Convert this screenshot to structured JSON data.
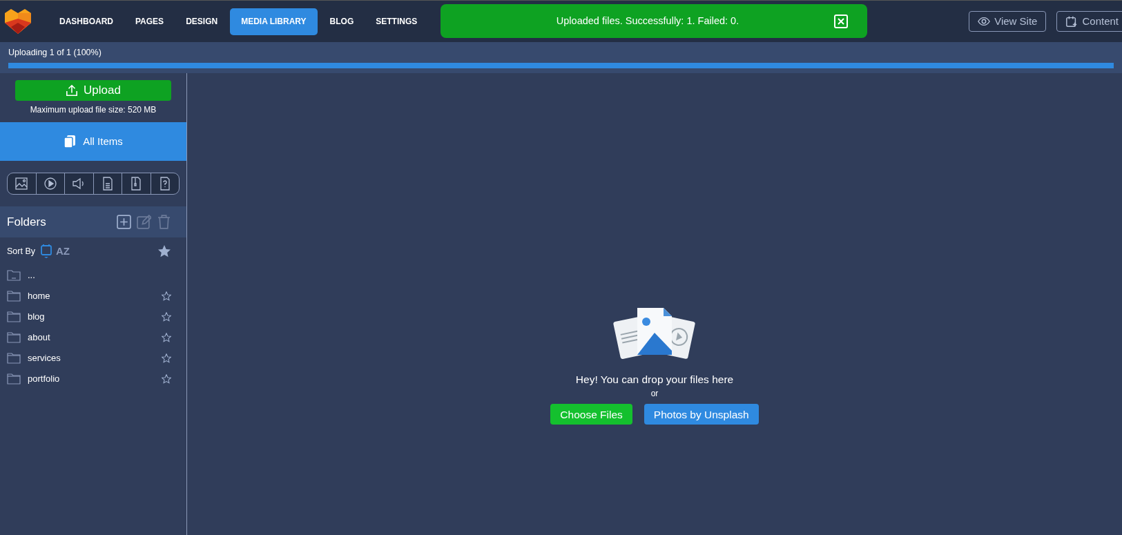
{
  "nav": {
    "tabs": [
      {
        "label": "DASHBOARD",
        "selected": false
      },
      {
        "label": "PAGES",
        "selected": false
      },
      {
        "label": "DESIGN",
        "selected": false
      },
      {
        "label": "MEDIA LIBRARY",
        "selected": true
      },
      {
        "label": "BLOG",
        "selected": false
      },
      {
        "label": "SETTINGS",
        "selected": false
      }
    ],
    "buttons": [
      {
        "kind": "view",
        "label": "View Site"
      },
      {
        "kind": "content",
        "label": "Content"
      }
    ]
  },
  "toast": {
    "message": "Uploaded files. Successfully: 1. Failed: 0."
  },
  "upload_progress": {
    "label": "Uploading 1 of 1 (100%)",
    "level": 1
  },
  "sidebar": {
    "upload_button": "Upload",
    "max_size": "Maximum upload file size: 520 MB",
    "all_items": {
      "label": "All Items",
      "selected": true
    },
    "folders_title": "Folders",
    "sort_label": "Sort By",
    "sort_options": [
      {
        "kind": "date",
        "selected": true
      },
      {
        "kind": "az",
        "label": "AZ",
        "selected": false
      }
    ],
    "folders": [
      {
        "kind": "parent",
        "name": "..."
      },
      {
        "kind": "folder",
        "name": "home",
        "starred": false
      },
      {
        "kind": "folder",
        "name": "blog",
        "starred": false
      },
      {
        "kind": "folder",
        "name": "about",
        "starred": false
      },
      {
        "kind": "folder",
        "name": "services",
        "starred": false
      },
      {
        "kind": "folder",
        "name": "portfolio",
        "starred": false
      }
    ]
  },
  "dropzone": {
    "message": "Hey! You can drop your files here",
    "or": "or",
    "buttons": [
      {
        "kind": "choose",
        "label": "Choose Files"
      },
      {
        "kind": "unsplash",
        "label": "Photos by Unsplash"
      }
    ]
  }
}
